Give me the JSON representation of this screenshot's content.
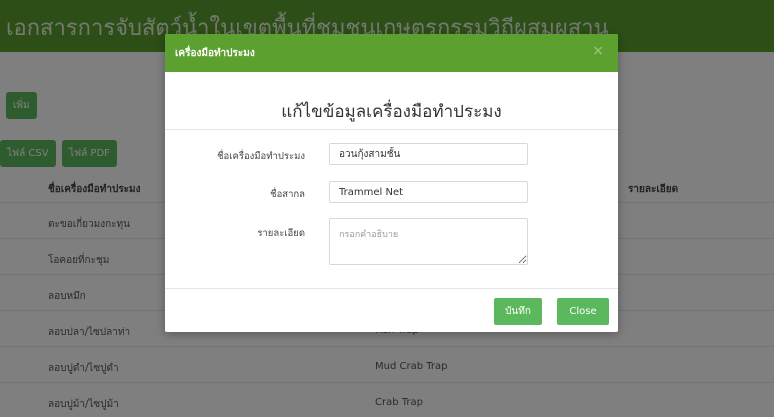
{
  "background": {
    "page_title": "เอกสารการจับสัตว์น้ำในเขตพื้นที่ชุมชนเกษตรกรรมวิถีผสมผสาน",
    "buttons": {
      "add": "เพิ่ม",
      "csv": "ไฟล์ CSV",
      "pdf": "ไฟล์ PDF"
    },
    "columns": {
      "name": "ชื่อเครื่องมือทำประมง",
      "detail": "รายละเอียด"
    },
    "rows": [
      {
        "name": "ตะขอเกี่ยวมงกะทุน",
        "intl": ""
      },
      {
        "name": "โอคอยที่กะชุม",
        "intl": ""
      },
      {
        "name": "ลอบหมึก",
        "intl": ""
      },
      {
        "name": "ลอบปลา/ไซปลาท่า",
        "intl": "Fish Trap"
      },
      {
        "name": "ลอบปูดำ/ไซปูดำ",
        "intl": "Mud Crab Trap"
      },
      {
        "name": "ลอบปูม้า/ไซปูม้า",
        "intl": "Crab Trap"
      }
    ]
  },
  "modal": {
    "header_title": "เครื่องมือทำประมง",
    "close_symbol": "×",
    "form_title": "แก้ไขข้อมูลเครื่องมือทำประมง",
    "fields": {
      "name": {
        "label": "ชื่อเครื่องมือทำประมง",
        "value": "อวนกุ้งสามชั้น"
      },
      "intl": {
        "label": "ชื่อสากล",
        "value": "Trammel Net"
      },
      "detail": {
        "label": "รายละเอียด",
        "placeholder": "กรอกคำอธิบาย"
      }
    },
    "buttons": {
      "save": "บันทึก",
      "close": "Close"
    }
  },
  "colors": {
    "header_green": "#5ca12f",
    "button_green": "#5cb85c"
  }
}
